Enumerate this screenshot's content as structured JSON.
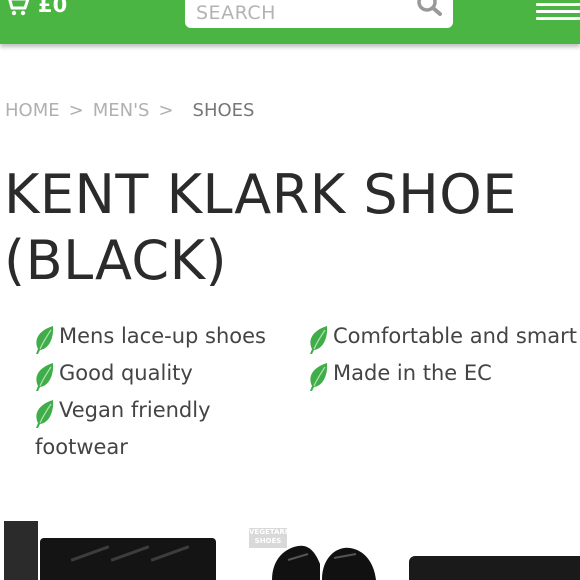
{
  "header": {
    "cart_total": "£0",
    "search": {
      "placeholder": "SEARCH"
    }
  },
  "breadcrumb": {
    "items": [
      "HOME",
      "MEN'S"
    ],
    "separator": ">",
    "current": "SHOES"
  },
  "product": {
    "title": "KENT KLARK SHOE (BLACK)",
    "features_left": [
      "Mens lace-up shoes",
      "Good quality",
      "Vegan friendly",
      "footwear"
    ],
    "features_right": [
      "Comfortable and smart",
      "Made in the EC"
    ]
  },
  "thumbnails": {
    "label_text": "VEGETARIAN SHOES"
  },
  "colors": {
    "brand": "#4bb543",
    "leaf": "#3fae49",
    "title": "#2b2b2b",
    "breadcrumb": "#b0b0b0"
  }
}
